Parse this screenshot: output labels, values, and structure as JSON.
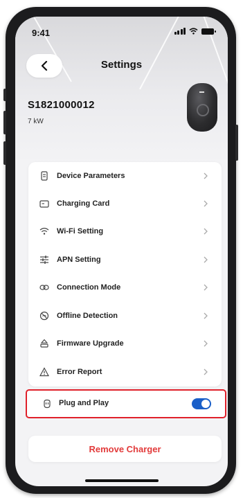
{
  "status_bar": {
    "time": "9:41"
  },
  "header": {
    "title": "Settings"
  },
  "device": {
    "id": "S1821000012",
    "power": "7 kW"
  },
  "menu": {
    "items": [
      {
        "label": "Device Parameters",
        "icon": "device-icon"
      },
      {
        "label": "Charging Card",
        "icon": "card-icon"
      },
      {
        "label": "Wi-Fi Setting",
        "icon": "wifi-icon"
      },
      {
        "label": "APN Setting",
        "icon": "sliders-icon"
      },
      {
        "label": "Connection Mode",
        "icon": "link-icon"
      },
      {
        "label": "Offline Detection",
        "icon": "offline-icon"
      },
      {
        "label": "Firmware Upgrade",
        "icon": "upgrade-icon"
      },
      {
        "label": "Error Report",
        "icon": "warning-icon"
      }
    ]
  },
  "plug_and_play": {
    "label": "Plug and Play",
    "enabled": true,
    "icon": "plug-icon"
  },
  "actions": {
    "remove_label": "Remove Charger"
  },
  "colors": {
    "accent": "#1a5fc8",
    "highlight_border": "#e0202a",
    "danger_text": "#e23a3a"
  }
}
